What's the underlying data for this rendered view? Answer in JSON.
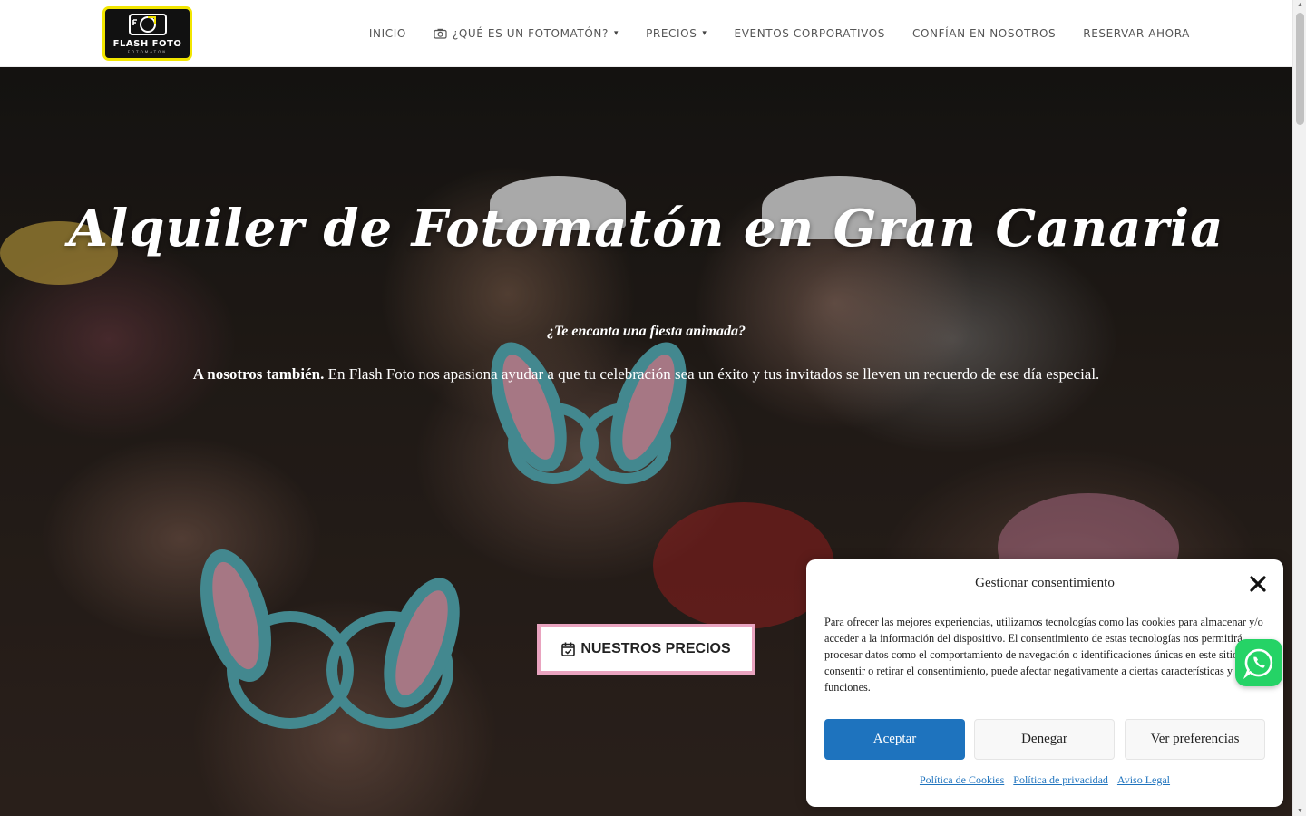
{
  "brand": {
    "logo_text": "FLASH FOTO",
    "logo_sub": "FOTOMATON",
    "accent": "#f2e600"
  },
  "nav": {
    "items": [
      {
        "label": "INICIO"
      },
      {
        "label": "¿QUÉ ES UN FOTOMATÓN?",
        "icon": "camera-icon",
        "has_dropdown": true
      },
      {
        "label": "PRECIOS",
        "has_dropdown": true
      },
      {
        "label": "EVENTOS CORPORATIVOS"
      },
      {
        "label": "CONFÍAN EN NOSOTROS"
      },
      {
        "label": "RESERVAR AHORA"
      }
    ]
  },
  "hero": {
    "title": "Alquiler de Fotomatón en Gran Canaria",
    "question": "¿Te encanta una fiesta animada?",
    "intro_bold": "A nosotros también.",
    "intro_rest": " En Flash Foto nos apasiona ayudar a que tu celebración sea un éxito y tus invitados se lleven un recuerdo de ese día especial.",
    "cta_label": "NUESTROS PRECIOS",
    "cta_border_color": "#e9a3bf"
  },
  "consent": {
    "title": "Gestionar consentimiento",
    "body": "Para ofrecer las mejores experiencias, utilizamos tecnologías como las cookies para almacenar y/o acceder a la información del dispositivo. El consentimiento de estas tecnologías nos permitirá procesar datos como el comportamiento de navegación o identificaciones únicas en este sitio. No consentir o retirar el consentimiento, puede afectar negativamente a ciertas características y funciones.",
    "accept": "Aceptar",
    "deny": "Denegar",
    "preferences": "Ver preferencias",
    "links": {
      "cookies": "Política de Cookies",
      "privacy": "Política de privacidad",
      "legal": "Aviso Legal"
    },
    "accept_color": "#1e73be"
  },
  "whatsapp": {
    "icon": "whatsapp-icon",
    "color": "#25d366"
  }
}
